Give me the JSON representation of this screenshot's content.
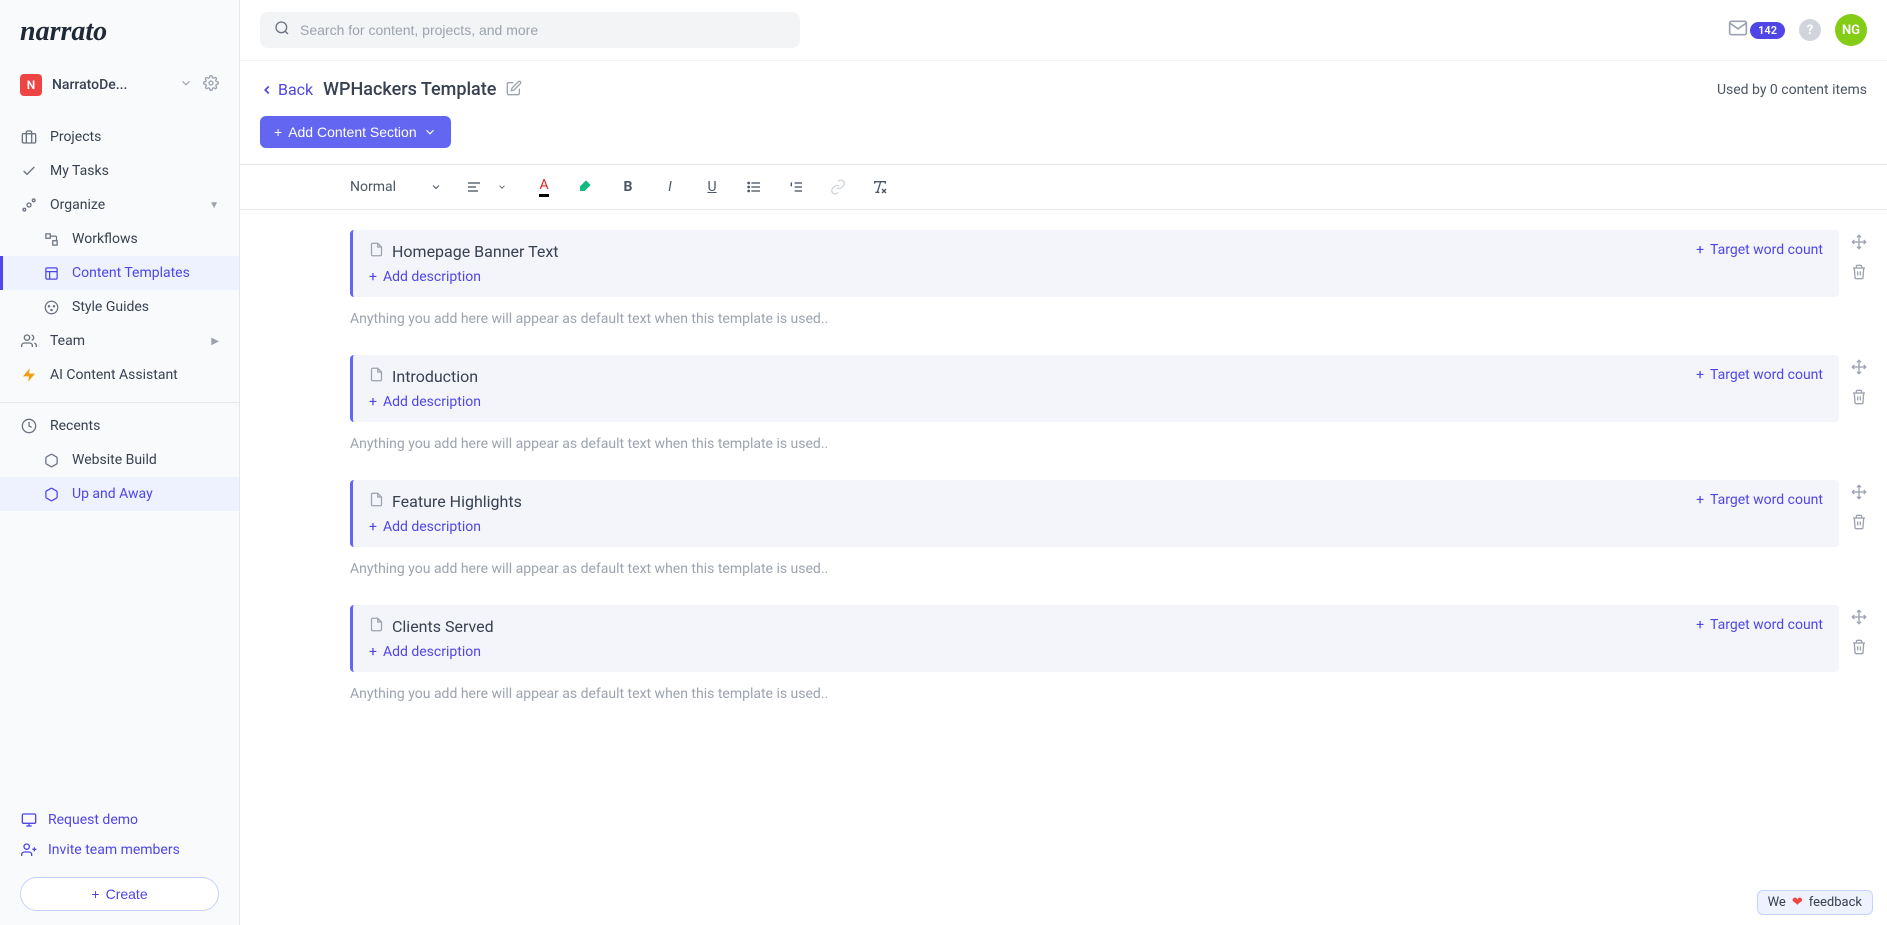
{
  "logo": "narrato",
  "workspace": {
    "badge": "N",
    "name": "NarratoDe..."
  },
  "search": {
    "placeholder": "Search for content, projects, and more"
  },
  "notifications": {
    "count": "142"
  },
  "avatar": "NG",
  "nav": {
    "projects": "Projects",
    "my_tasks": "My Tasks",
    "organize": "Organize",
    "workflows": "Workflows",
    "content_templates": "Content Templates",
    "style_guides": "Style Guides",
    "team": "Team",
    "ai": "AI Content Assistant",
    "recents": "Recents",
    "recent_items": [
      "Website Build",
      "Up and Away"
    ]
  },
  "sidebar_footer": {
    "request_demo": "Request demo",
    "invite": "Invite team members",
    "create": "Create"
  },
  "back": "Back",
  "page_title": "WPHackers Template",
  "usage": "Used by 0 content items",
  "add_section": "Add Content Section",
  "toolbar": {
    "heading": "Normal"
  },
  "section_common": {
    "add_description": "Add description",
    "target_word_count": "Target word count",
    "placeholder": "Anything you add here will appear as default text when this template is used.."
  },
  "sections": [
    {
      "title": "Homepage Banner Text"
    },
    {
      "title": "Introduction"
    },
    {
      "title": "Feature Highlights"
    },
    {
      "title": "Clients Served"
    }
  ],
  "feedback": {
    "we": "We",
    "text": "feedback"
  }
}
